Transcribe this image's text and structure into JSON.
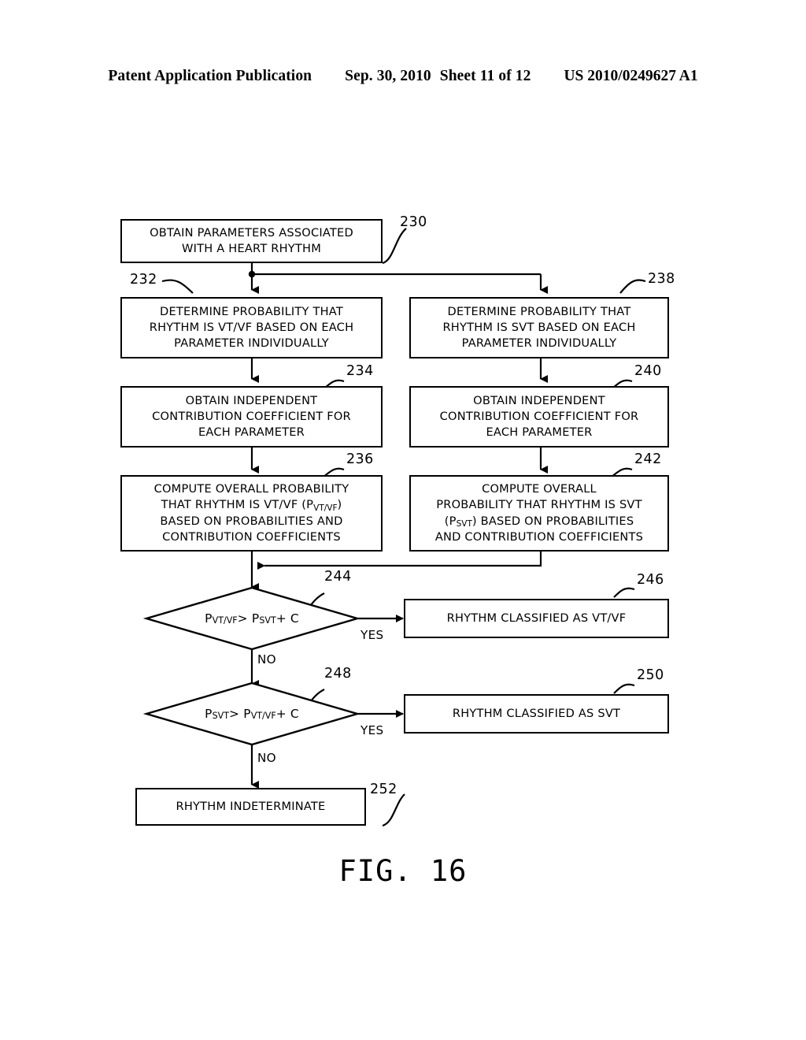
{
  "header": {
    "publication": "Patent Application Publication",
    "date": "Sep. 30, 2010",
    "sheet": "Sheet 11 of 12",
    "patent_number": "US 2010/0249627 A1"
  },
  "figure": {
    "caption": "FIG. 16"
  },
  "nodes": {
    "n230": {
      "ref": "230",
      "type": "process",
      "lines": [
        "OBTAIN PARAMETERS ASSOCIATED",
        "WITH A HEART RHYTHM"
      ]
    },
    "n232": {
      "ref": "232",
      "type": "process",
      "lines": [
        "DETERMINE PROBABILITY THAT",
        "RHYTHM IS VT/VF BASED ON EACH",
        "PARAMETER INDIVIDUALLY"
      ]
    },
    "n238": {
      "ref": "238",
      "type": "process",
      "lines": [
        "DETERMINE PROBABILITY THAT",
        "RHYTHM IS SVT BASED ON EACH",
        "PARAMETER INDIVIDUALLY"
      ]
    },
    "n234": {
      "ref": "234",
      "type": "process",
      "lines": [
        "OBTAIN INDEPENDENT",
        "CONTRIBUTION COEFFICIENT FOR",
        "EACH PARAMETER"
      ]
    },
    "n240": {
      "ref": "240",
      "type": "process",
      "lines": [
        "OBTAIN INDEPENDENT",
        "CONTRIBUTION COEFFICIENT FOR",
        "EACH PARAMETER"
      ]
    },
    "n236": {
      "ref": "236",
      "type": "process",
      "lines_html": [
        "COMPUTE OVERALL PROBABILITY",
        "THAT RHYTHM IS VT/VF (P<sub>VT/VF</sub>)",
        "BASED ON PROBABILITIES AND",
        "CONTRIBUTION COEFFICIENTS"
      ]
    },
    "n242": {
      "ref": "242",
      "type": "process",
      "lines_html": [
        "COMPUTE OVERALL",
        "PROBABILITY THAT RHYTHM IS SVT",
        "(P<sub>SVT</sub>) BASED ON PROBABILITIES",
        "AND CONTRIBUTION COEFFICIENTS"
      ]
    },
    "n244": {
      "ref": "244",
      "type": "decision",
      "label_html": "P<sub>VT/VF</sub> &gt; P<sub>SVT</sub> + C",
      "yes_label": "YES",
      "no_label": "NO"
    },
    "n248": {
      "ref": "248",
      "type": "decision",
      "label_html": "P<sub>SVT</sub> &gt; P<sub>VT/VF</sub> + C",
      "yes_label": "YES",
      "no_label": "NO"
    },
    "n246": {
      "ref": "246",
      "type": "process",
      "lines": [
        "RHYTHM CLASSIFIED AS VT/VF"
      ]
    },
    "n250": {
      "ref": "250",
      "type": "process",
      "lines": [
        "RHYTHM CLASSIFIED AS SVT"
      ]
    },
    "n252": {
      "ref": "252",
      "type": "process",
      "lines": [
        "RHYTHM INDETERMINATE"
      ]
    }
  },
  "colors": {
    "stroke": "#000000",
    "background": "#ffffff"
  }
}
